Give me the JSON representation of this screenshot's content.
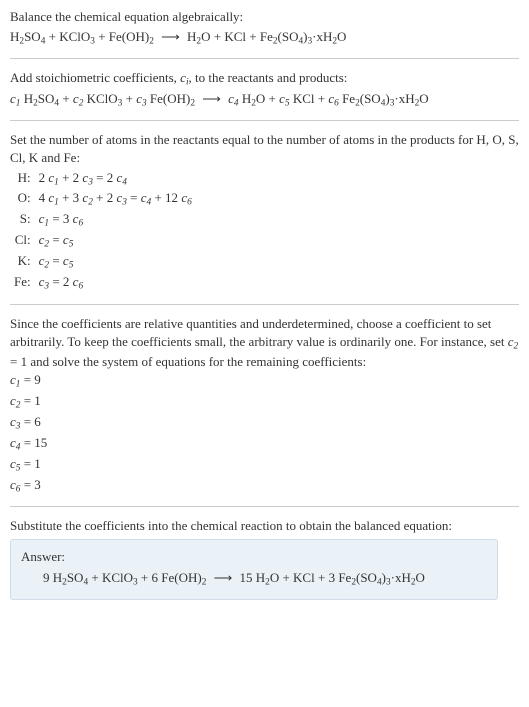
{
  "intro": {
    "line1": "Balance the chemical equation algebraically:"
  },
  "stoich": {
    "text": "Add stoichiometric coefficients, ",
    "ci": "c",
    "ci_sub": "i",
    "text2": ", to the reactants and products:"
  },
  "atoms_intro": "Set the number of atoms in the reactants equal to the number of atoms in the products for H, O, S, Cl, K and Fe:",
  "atom_rows": [
    {
      "el": "H:",
      "eq_a": "2",
      "eq_b": " + 2",
      "eq_c": " = 2",
      "idx": {
        "a": "1",
        "b": "3",
        "c": "4"
      }
    },
    {
      "el": "O:",
      "eq_a": "4",
      "eq_b": " + 3",
      "eq_b2": " + 2",
      "eq_c": " = ",
      "eq_c2": " + 12",
      "idx": {
        "a": "1",
        "b": "2",
        "b2": "3",
        "c": "4",
        "c2": "6"
      }
    },
    {
      "el": "S:",
      "eq_a": "",
      "eq_c": " = 3",
      "idx": {
        "a": "1",
        "c": "6"
      }
    },
    {
      "el": "Cl:",
      "eq_a": "",
      "eq_c": " = ",
      "idx": {
        "a": "2",
        "c": "5"
      }
    },
    {
      "el": "K:",
      "eq_a": "",
      "eq_c": " = ",
      "idx": {
        "a": "2",
        "c": "5"
      }
    },
    {
      "el": "Fe:",
      "eq_a": "",
      "eq_c": " = 2",
      "idx": {
        "a": "3",
        "c": "6"
      }
    }
  ],
  "underdet": {
    "p1": "Since the coefficients are relative quantities and underdetermined, choose a coefficient to set arbitrarily. To keep the coefficients small, the arbitrary value is ordinarily one. For instance, set ",
    "set": "c",
    "set_sub": "2",
    "set_val": " = 1",
    "p2": " and solve the system of equations for the remaining coefficients:"
  },
  "coefs": [
    {
      "c": "1",
      "v": "9"
    },
    {
      "c": "2",
      "v": "1"
    },
    {
      "c": "3",
      "v": "6"
    },
    {
      "c": "4",
      "v": "15"
    },
    {
      "c": "5",
      "v": "1"
    },
    {
      "c": "6",
      "v": "3"
    }
  ],
  "subst": "Substitute the coefficients into the chemical reaction to obtain the balanced equation:",
  "answer": {
    "label": "Answer:",
    "n1": "9",
    "n3": "6",
    "n4": "15",
    "n6": "3"
  },
  "species": {
    "h2so4_a": "H",
    "h2so4_b": "SO",
    "kclo3_a": "KClO",
    "feoh2_a": "Fe(OH)",
    "h2o_a": "H",
    "h2o_b": "O",
    "kcl": "KCl",
    "fe2so4_a": "Fe",
    "fe2so4_b": "(SO",
    "fe2so4_c": ")",
    "fe2so4_d": "·xH",
    "fe2so4_e": "O",
    "plus": " + ",
    "arrow": "⟶"
  }
}
